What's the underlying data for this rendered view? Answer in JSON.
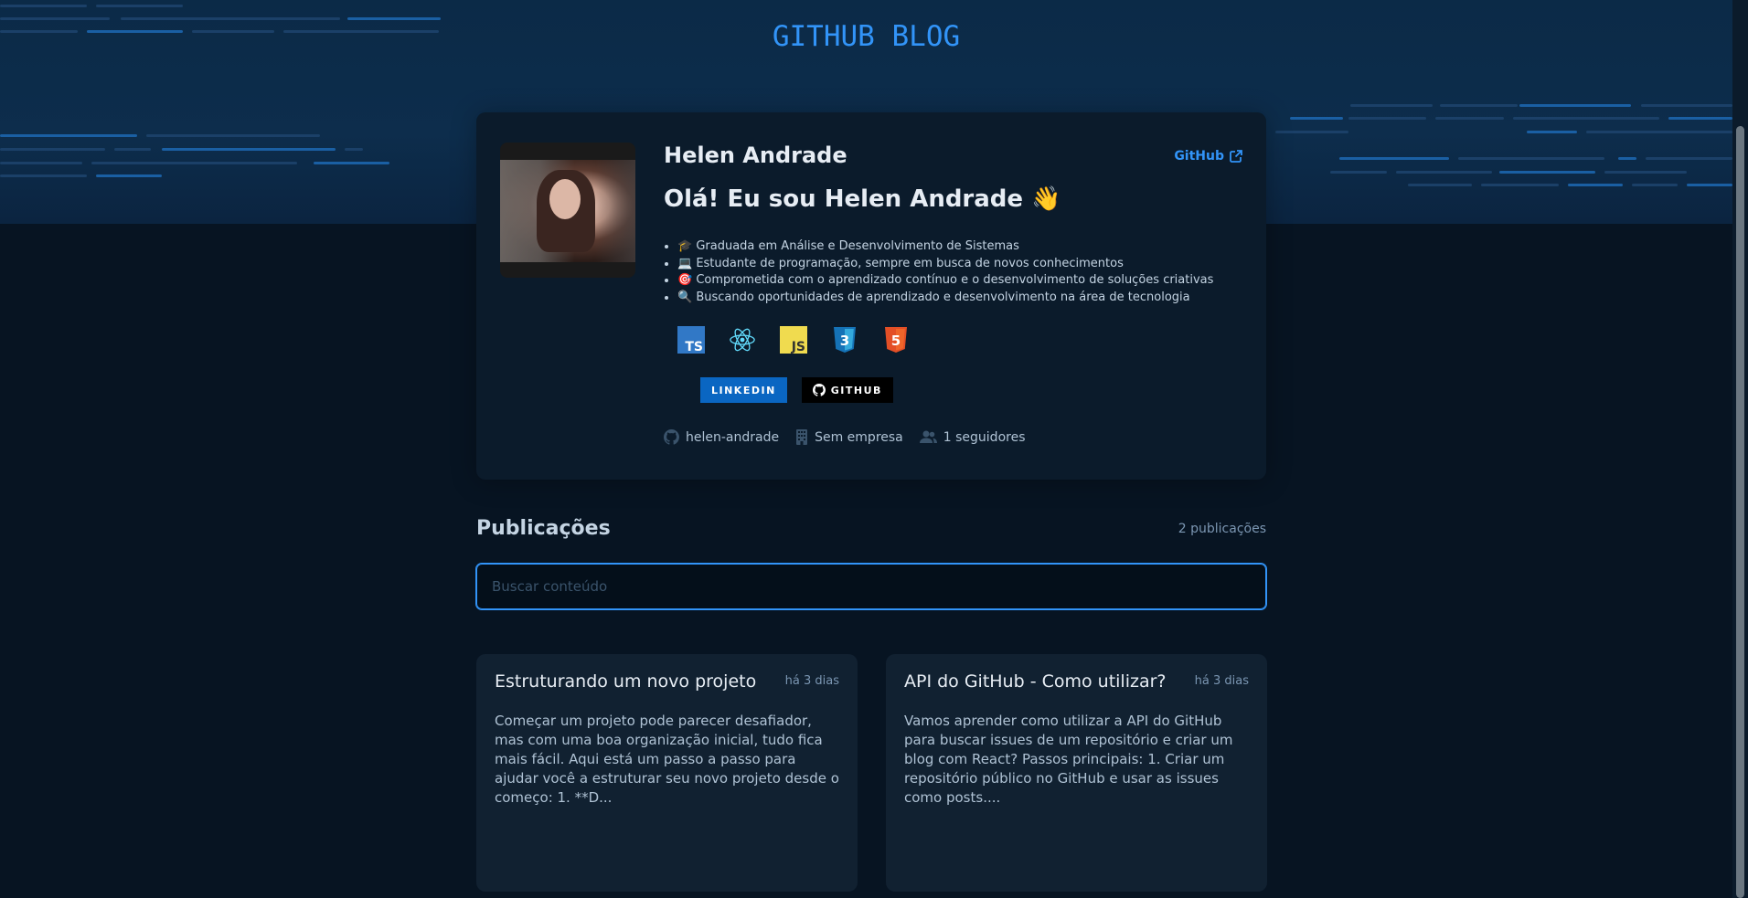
{
  "header": {
    "title": "GITHUB BLOG"
  },
  "profile": {
    "name": "Helen Andrade",
    "github_link": "GitHub",
    "greeting": "Olá! Eu sou Helen Andrade 👋",
    "bio": [
      "🎓 Graduada em Análise e Desenvolvimento de Sistemas",
      "💻 Estudante de programação, sempre em busca de novos conhecimentos",
      "🎯 Comprometida com o aprendizado contínuo e o desenvolvimento de soluções criativas",
      "🔍 Buscando oportunidades de aprendizado e desenvolvimento na área de tecnologia"
    ],
    "techs": [
      {
        "name": "typescript-icon",
        "label": "TS",
        "color": "#3178c6"
      },
      {
        "name": "react-icon",
        "color": "#61dafb"
      },
      {
        "name": "javascript-icon",
        "label": "JS",
        "color": "#f0db4f"
      },
      {
        "name": "css3-icon",
        "label": "3",
        "color": "#1572b6"
      },
      {
        "name": "html5-icon",
        "label": "5",
        "color": "#e34f26"
      }
    ],
    "badges": {
      "linkedin": "LINKEDIN",
      "github": "GITHUB"
    },
    "meta": {
      "username": "helen-andrade",
      "company": "Sem empresa",
      "followers": "1 seguidores"
    }
  },
  "publications": {
    "heading": "Publicações",
    "count": "2 publicações",
    "search_placeholder": "Buscar conteúdo",
    "posts": [
      {
        "title": "Estruturando um novo projeto",
        "date": "há 3 dias",
        "excerpt": "Começar um projeto pode parecer desafiador, mas com uma boa organização inicial, tudo fica mais fácil. Aqui está um passo a passo para ajudar você a estruturar seu novo projeto desde o começo: 1. **D..."
      },
      {
        "title": "API do GitHub - Como utilizar?",
        "date": "há 3 dias",
        "excerpt": "Vamos aprender como utilizar a API do GitHub para buscar issues de um repositório e criar um blog com React? Passos principais: 1. Criar um repositório público no GitHub e usar as issues como posts...."
      }
    ]
  },
  "colors": {
    "accent": "#3294f8",
    "background": "#071422",
    "card": "#0b1b2b",
    "post_card": "#112131"
  }
}
